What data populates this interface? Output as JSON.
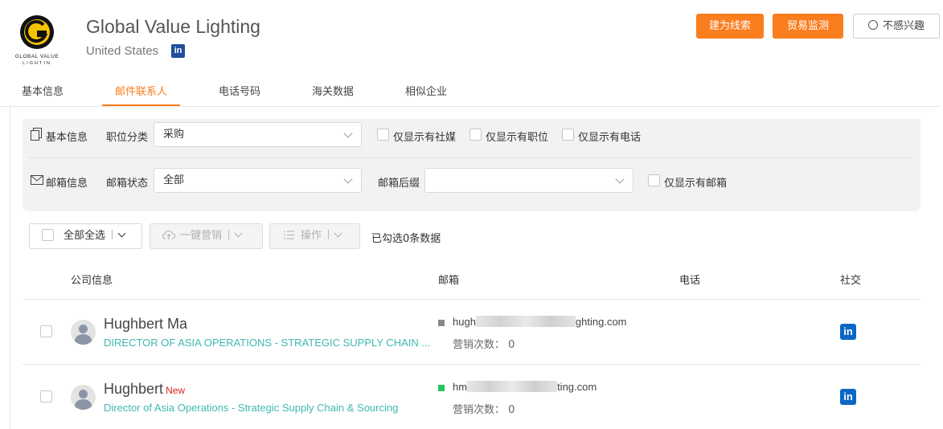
{
  "company": {
    "name": "Global Value Lighting",
    "country": "United States",
    "logo_text": "GLOBAL VALUE LIGHTING",
    "linkedin_badge": "in"
  },
  "actions": {
    "lead": "建为线索",
    "trade": "贸易监测",
    "no_interest": "不感兴趣"
  },
  "colors": {
    "accent": "#fa7d1e",
    "teal_link": "#3fb8b0",
    "linkedin": "#0a66c2"
  },
  "tabs": [
    {
      "label": "基本信息"
    },
    {
      "label": "邮件联系人",
      "active": true
    },
    {
      "label": "电话号码"
    },
    {
      "label": "海关数据"
    },
    {
      "label": "相似企业"
    }
  ],
  "filters": {
    "basic": {
      "section_label": "基本信息",
      "job_category_label": "职位分类",
      "job_category_value": "采购",
      "only_social": "仅显示有社媒",
      "only_position": "仅显示有职位",
      "only_phone": "仅显示有电话"
    },
    "email": {
      "section_label": "邮箱信息",
      "status_label": "邮箱状态",
      "status_value": "全部",
      "suffix_label": "邮箱后缀",
      "suffix_value": "",
      "only_email": "仅显示有邮箱"
    }
  },
  "toolbar": {
    "select_all": "全部全选",
    "one_click_marketing": "一键营销",
    "operations": "操作",
    "selected_count": "已勾选0条数据"
  },
  "table": {
    "headers": {
      "company": "公司信息",
      "email": "邮箱",
      "phone": "电话",
      "social": "社交"
    },
    "rows": [
      {
        "name": "Hughbert Ma",
        "badge": "",
        "title": "DIRECTOR OF ASIA OPERATIONS - STRATEGIC SUPPLY CHAIN ...",
        "email_prefix": "hugh",
        "email_suffix": "ghting.com",
        "status_color": "#888888",
        "marketing_label": "营销次数：",
        "marketing_count": "0",
        "social": "in"
      },
      {
        "name": "Hughbert",
        "badge": "New",
        "title": "Director of Asia Operations - Strategic Supply Chain & Sourcing",
        "email_prefix": "hm",
        "email_suffix": "ting.com",
        "status_color": "#22c55e",
        "marketing_label": "营销次数：",
        "marketing_count": "0",
        "social": "in"
      }
    ]
  }
}
